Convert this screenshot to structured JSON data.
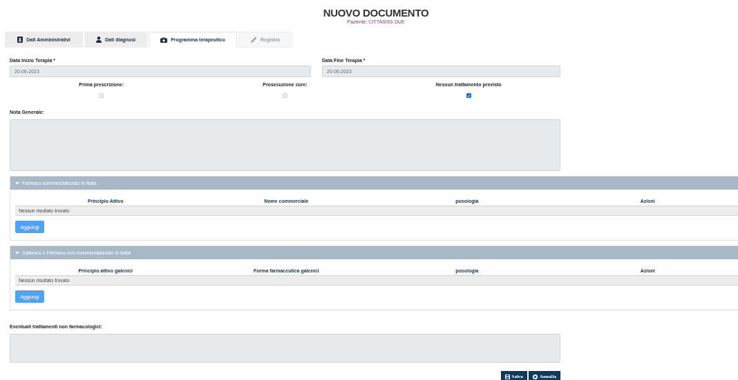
{
  "title": "NUOVO DOCUMENTO",
  "subtitle": "Paziente: CITTASISS DUE",
  "tabs": [
    {
      "label": "Dati Amministrativi",
      "kind": "id",
      "selected": false,
      "disabled": false
    },
    {
      "label": "Dati diagnosi",
      "kind": "doctor",
      "selected": false,
      "disabled": false
    },
    {
      "label": "Programma terapeutico",
      "kind": "kit",
      "selected": true,
      "disabled": false
    },
    {
      "label": "Registra",
      "kind": "pencil",
      "selected": false,
      "disabled": true
    }
  ],
  "dates": [
    {
      "label": "Data Inizio Terapia *",
      "value": "20-06-2023"
    },
    {
      "label": "Data Fine Terapia *",
      "value": "20-06-2023"
    }
  ],
  "checkboxes": [
    {
      "label": "Prima prescrizione:",
      "checked": false,
      "disabled": true
    },
    {
      "label": "Prosecuzione cure:",
      "checked": false,
      "disabled": true
    },
    {
      "label": "Nessun trattamento previsto",
      "checked": true,
      "disabled": false
    }
  ],
  "note": {
    "label": "Nota Generale:"
  },
  "panels": [
    {
      "title": "Farmaco commercializzato in Italia",
      "expanded": true,
      "columns": [
        "Principio Attivo",
        "Nome commerciale",
        "posologia",
        "Azioni"
      ],
      "empty": "Nessun risultato trovato",
      "button": "Aggiungi"
    },
    {
      "title": "Galenico o Farmaco non commercializzato in Italia",
      "expanded": true,
      "columns": [
        "Principio attivo galenici",
        "Forma farmaceutica galenici",
        "posologia",
        "Azioni"
      ],
      "empty": "Nessun risultato trovato",
      "button": "Aggiungi"
    }
  ],
  "other": {
    "label": "Eventuali trattamenti non farmacologici:"
  },
  "actions": [
    {
      "label": "Salva",
      "kind": "save"
    },
    {
      "label": "Annulla",
      "kind": "cancel"
    }
  ]
}
